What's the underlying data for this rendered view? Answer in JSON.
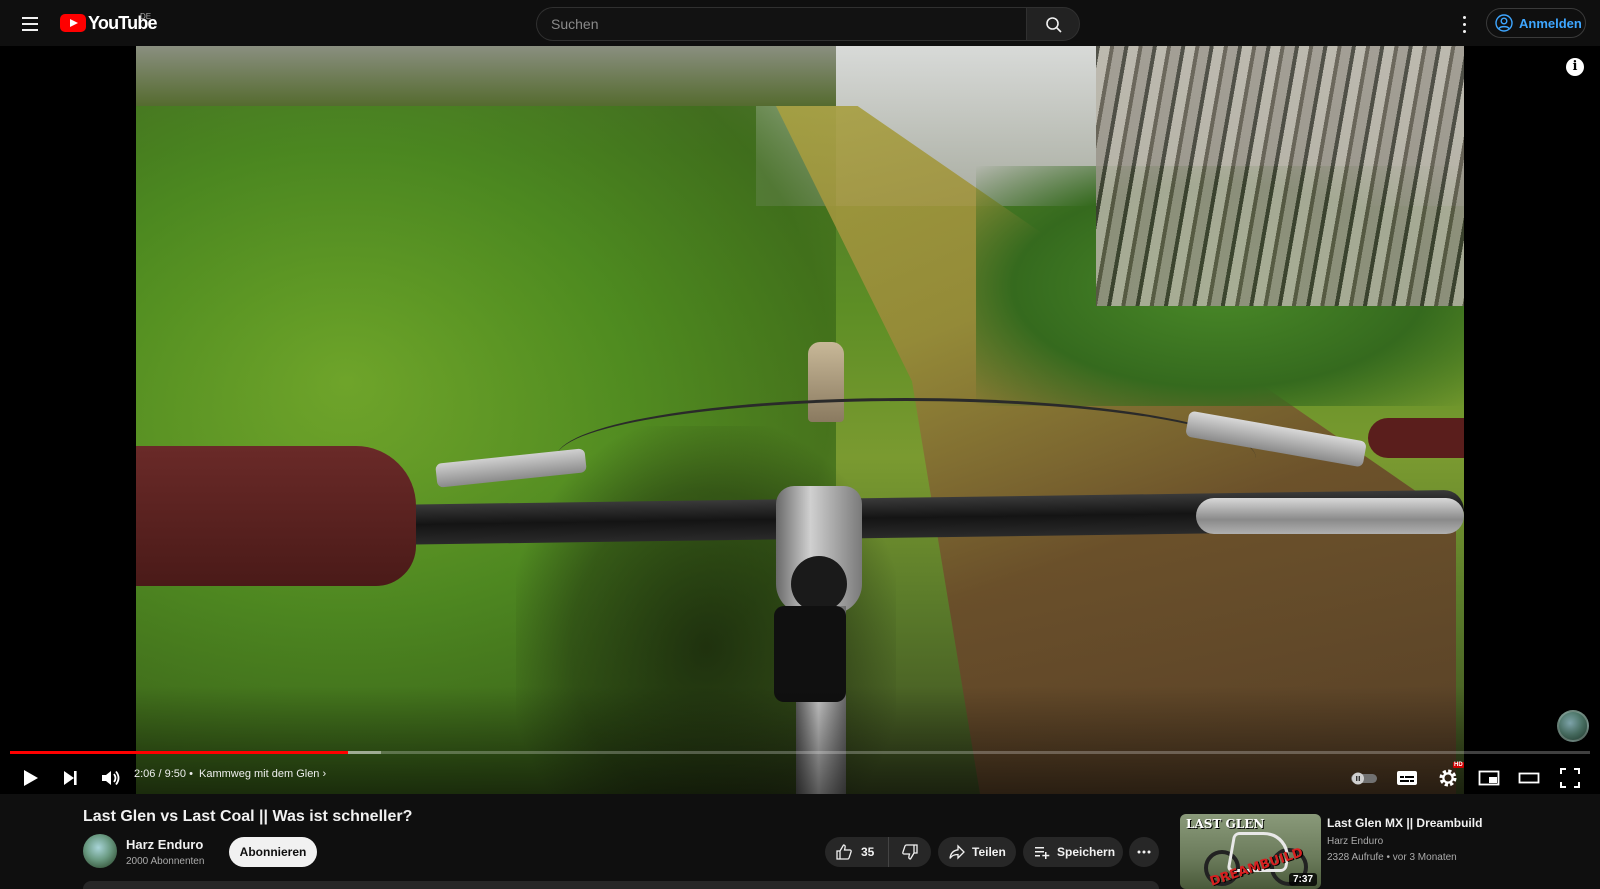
{
  "masthead": {
    "logo_text": "YouTube",
    "country_code": "DE",
    "search_placeholder": "Suchen",
    "signin_label": "Anmelden"
  },
  "player": {
    "current_time": "2:06",
    "duration": "9:50",
    "time_separator": "/",
    "chapter_separator": "•",
    "chapter": "Kammweg mit dem Glen",
    "chapter_chevron": "›",
    "progress_played_fraction": 0.214,
    "progress_loaded_fraction": 0.235,
    "hd_badge": "HD",
    "info_glyph": "i"
  },
  "video": {
    "title": "Last Glen vs Last Coal || Was ist schneller?"
  },
  "channel": {
    "name": "Harz Enduro",
    "subscribers": "2000 Abonnenten",
    "subscribe_label": "Abonnieren"
  },
  "actions": {
    "like_count": "35",
    "share_label": "Teilen",
    "save_label": "Speichern"
  },
  "recommendation": {
    "thumb_title": "LAST GLEN",
    "thumb_overlay": "DREAMBUILD",
    "duration": "7:37",
    "title": "Last Glen MX || Dreambuild",
    "channel": "Harz Enduro",
    "views": "2328 Aufrufe",
    "meta_separator": "•",
    "age": "vor 3 Monaten"
  },
  "colors": {
    "accent_red": "#ff0000",
    "signin_blue": "#3ea6ff",
    "background": "#0f0f0f"
  },
  "icons": [
    "menu-icon",
    "youtube-logo-icon",
    "search-icon",
    "more-vert-icon",
    "account-icon",
    "info-icon",
    "play-icon",
    "next-icon",
    "volume-icon",
    "autoplay-toggle-icon",
    "subtitles-icon",
    "settings-icon",
    "miniplayer-icon",
    "theater-icon",
    "fullscreen-icon",
    "thumbs-up-icon",
    "thumbs-down-icon",
    "share-icon",
    "save-playlist-icon",
    "more-horiz-icon"
  ]
}
